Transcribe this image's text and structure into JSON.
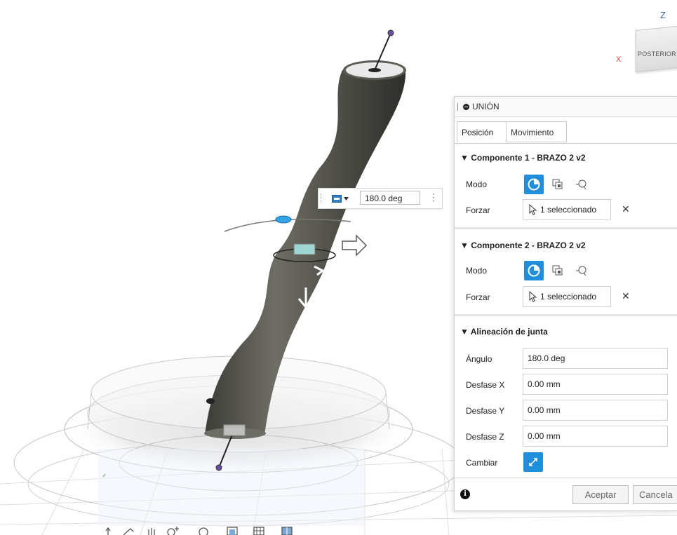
{
  "viewcube": {
    "face_label": "POSTERIOR",
    "axis_z": "Z",
    "axis_x": "X"
  },
  "manipulator": {
    "angle_value": "180.0 deg"
  },
  "panel": {
    "title": "UNIÓN",
    "tabs": [
      {
        "label": "Posición"
      },
      {
        "label": "Movimiento"
      }
    ],
    "component1": {
      "title": "Componente 1 - BRAZO 2 v2",
      "mode_label": "Modo",
      "force_label": "Forzar",
      "selection": "1 seleccionado"
    },
    "component2": {
      "title": "Componente 2 - BRAZO 2 v2",
      "mode_label": "Modo",
      "force_label": "Forzar",
      "selection": "1 seleccionado"
    },
    "alignment": {
      "title": "Alineación de junta",
      "angle_label": "Ángulo",
      "angle_value": "180.0 deg",
      "offset_x_label": "Desfase X",
      "offset_x_value": "0.00 mm",
      "offset_y_label": "Desfase Y",
      "offset_y_value": "0.00 mm",
      "offset_z_label": "Desfase Z",
      "offset_z_value": "0.00 mm",
      "flip_label": "Cambiar"
    },
    "footer": {
      "ok_label": "Aceptar",
      "cancel_label": "Cancela"
    }
  },
  "icons": {
    "header_dot": "joint-icon",
    "mode": [
      "snap-point-icon",
      "between-two-faces-icon",
      "two-edge-intersection-icon"
    ],
    "pointer": "cursor-arrow-icon",
    "clear": "close-icon",
    "swap": "flip-arrows-icon",
    "info": "info-icon"
  },
  "colors": {
    "accent": "#1f8fdb",
    "joint_marker": "#6b4fa0",
    "model": "#5a5a52"
  }
}
